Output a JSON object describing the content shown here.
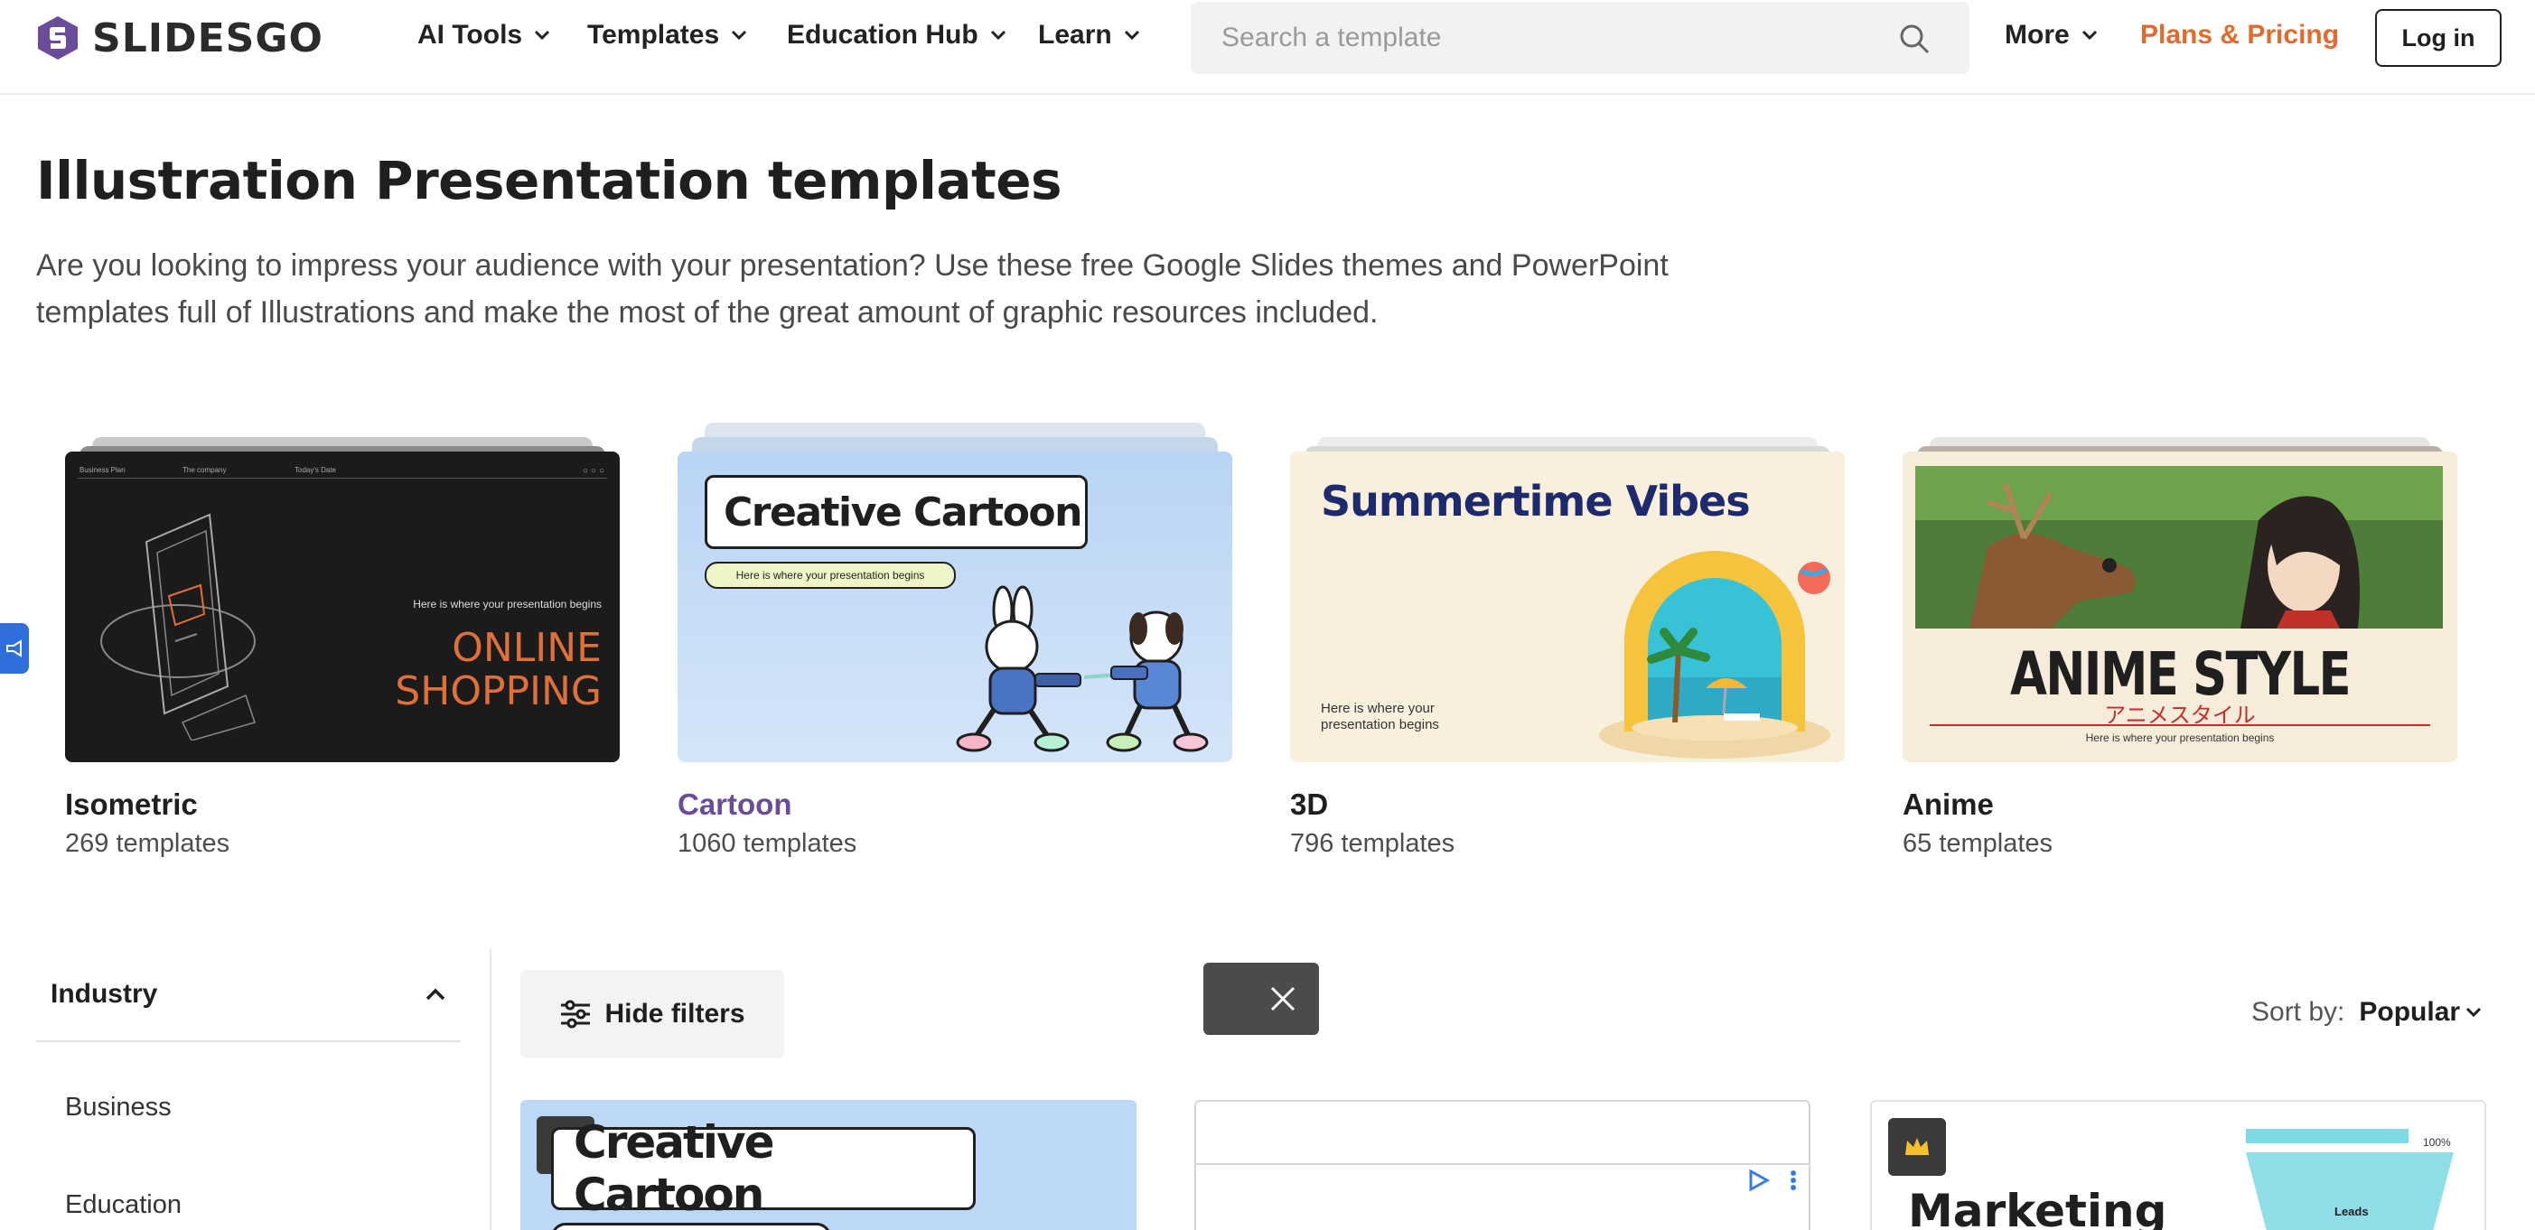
{
  "brand": {
    "name": "SLIDESGO",
    "accent": "#6b4c9a",
    "pricing_color": "#e36a2c"
  },
  "nav": {
    "items": [
      {
        "label": "AI Tools"
      },
      {
        "label": "Templates"
      },
      {
        "label": "Education Hub"
      },
      {
        "label": "Learn"
      }
    ],
    "more": "More",
    "pricing": "Plans & Pricing",
    "login": "Log in"
  },
  "search": {
    "placeholder": "Search a template",
    "icon": "search-icon"
  },
  "page": {
    "title": "Illustration Presentation templates",
    "description": "Are you looking to impress your audience with your presentation? Use these free Google Slides themes and PowerPoint templates full of Illustrations and make the most of the great amount of graphic resources included."
  },
  "categories": [
    {
      "name": "Isometric",
      "count": "269 templates",
      "thumb": {
        "top_labels": [
          "Business Plan",
          "The company",
          "Today's Date"
        ],
        "subtitle": "Here is where your presentation begins",
        "headline": "ONLINE SHOPPING"
      }
    },
    {
      "name": "Cartoon",
      "count": "1060 templates",
      "thumb": {
        "headline": "Creative Cartoon",
        "subtitle": "Here is where your presentation begins"
      }
    },
    {
      "name": "3D",
      "count": "796 templates",
      "thumb": {
        "headline": "Summertime Vibes",
        "subtitle": "Here is where your presentation begins"
      }
    },
    {
      "name": "Anime",
      "count": "65 templates",
      "thumb": {
        "headline": "ANIME STYLE",
        "subheadline": "アニメスタイル",
        "subtitle": "Here is where your presentation begins"
      }
    }
  ],
  "filters": {
    "section": "Industry",
    "items": [
      "Business",
      "Education"
    ],
    "hide_label": "Hide filters"
  },
  "sort": {
    "label": "Sort by:",
    "value": "Popular"
  },
  "results": [
    {
      "title": "Creative Cartoon",
      "premium": true
    },
    {
      "title": "",
      "premium": false
    },
    {
      "title": "Marketing",
      "premium": true,
      "chart_labels": [
        "100%",
        "Leads"
      ]
    }
  ]
}
